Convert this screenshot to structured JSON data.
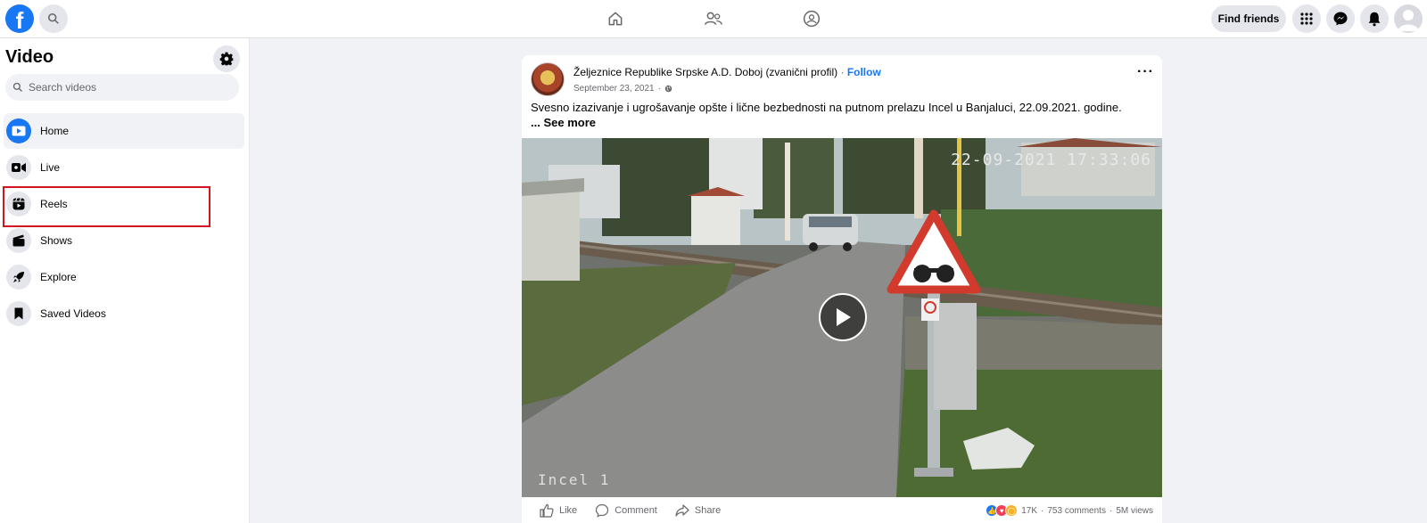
{
  "topbar": {
    "logo_letter": "f",
    "find_friends_label": "Find friends"
  },
  "sidebar": {
    "title": "Video",
    "search_placeholder": "Search videos",
    "items": [
      {
        "label": "Home",
        "icon": "video-play-icon",
        "active": true
      },
      {
        "label": "Live",
        "icon": "live-camera-icon"
      },
      {
        "label": "Reels",
        "icon": "reels-icon"
      },
      {
        "label": "Shows",
        "icon": "clapperboard-icon"
      },
      {
        "label": "Explore",
        "icon": "rocket-icon"
      },
      {
        "label": "Saved Videos",
        "icon": "bookmark-icon"
      }
    ]
  },
  "post": {
    "author": "Željeznice Republike Srpske A.D. Doboj (zvanični profil)",
    "separator": " · ",
    "follow_label": "Follow",
    "date": "September 23, 2021",
    "date_separator": "·",
    "text": "Svesno izazivanje i ugrošavanje opšte i lične bezbednosti na putnom prelazu Incel u Banjaluci, 22.09.2021. godine.",
    "see_more": "... See more",
    "video": {
      "timestamp": "22-09-2021 17:33:06",
      "camera_label": "Incel  1"
    },
    "actions": {
      "like": "Like",
      "comment": "Comment",
      "share": "Share"
    },
    "stats": {
      "reactions": "17K",
      "comments": "753 comments",
      "views": "5M views",
      "separator": "·"
    }
  },
  "colors": {
    "brand": "#1877f2",
    "highlight": "#d0171f"
  }
}
